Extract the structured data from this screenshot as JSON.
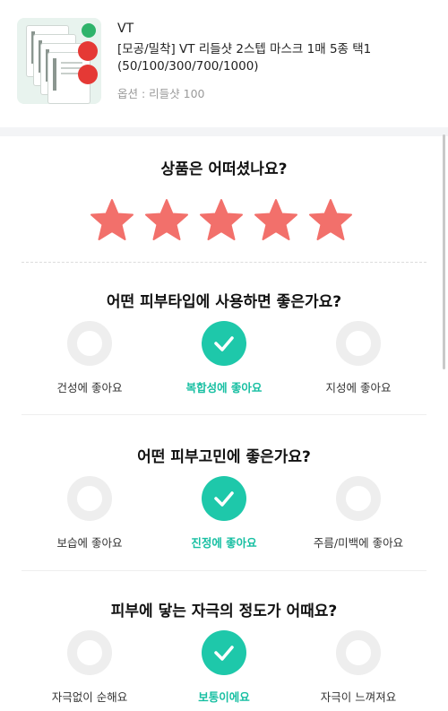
{
  "product": {
    "brand": "VT",
    "name": "[모공/밀착] VT 리들샷 2스텝 마스크 1매 5종 택1 (50/100/300/700/1000)",
    "option": "옵션 : 리들샷 100"
  },
  "rating": {
    "question": "상품은 어떠셨나요?",
    "stars": 5,
    "max": 5,
    "star_color": "#f2706b"
  },
  "questions": [
    {
      "title": "어떤 피부타입에 사용하면 좋은가요?",
      "options": [
        {
          "label": "건성에 좋아요",
          "selected": false
        },
        {
          "label": "복합성에 좋아요",
          "selected": true
        },
        {
          "label": "지성에 좋아요",
          "selected": false
        }
      ]
    },
    {
      "title": "어떤 피부고민에 좋은가요?",
      "options": [
        {
          "label": "보습에 좋아요",
          "selected": false
        },
        {
          "label": "진정에 좋아요",
          "selected": true
        },
        {
          "label": "주름/미백에 좋아요",
          "selected": false
        }
      ]
    },
    {
      "title": "피부에 닿는 자극의 정도가 어때요?",
      "options": [
        {
          "label": "자극없이 순해요",
          "selected": false
        },
        {
          "label": "보통이에요",
          "selected": true
        },
        {
          "label": "자극이 느껴져요",
          "selected": false
        }
      ]
    }
  ],
  "colors": {
    "accent": "#1ec8aa",
    "accent_text": "#17bfa2",
    "unselected_ring": "#eeeeee",
    "star": "#f2706b"
  }
}
